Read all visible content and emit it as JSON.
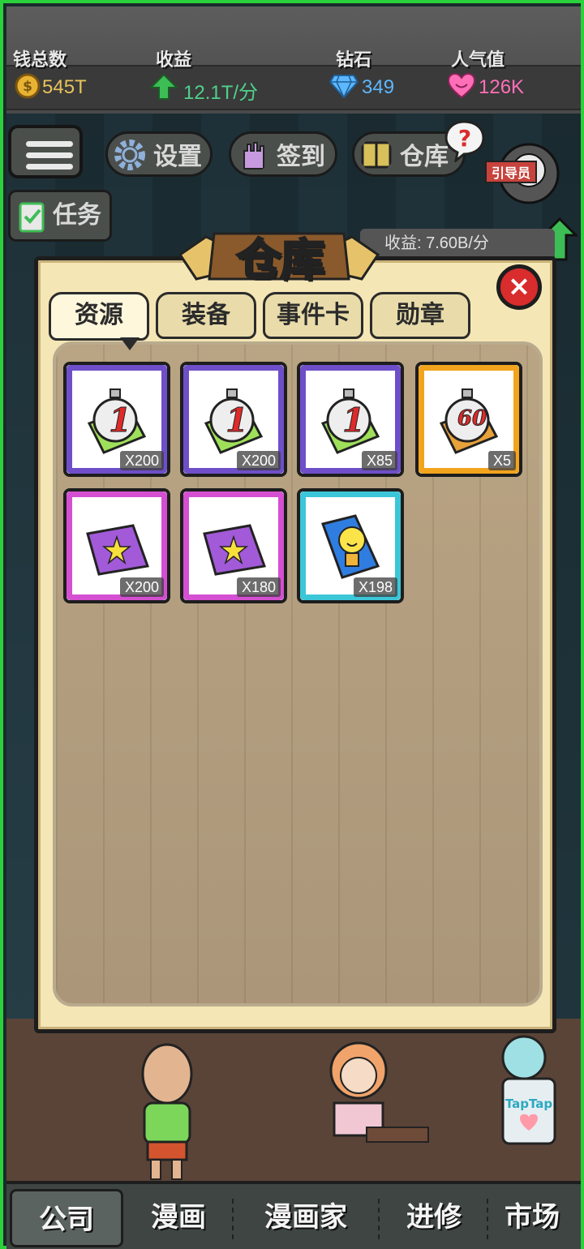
{
  "status": {
    "money": {
      "label": "钱总数",
      "value": "545T",
      "color": "#e8c25a"
    },
    "income": {
      "label": "收益",
      "value": "12.1T/分",
      "color": "#4fd18a"
    },
    "diamond": {
      "label": "钻石",
      "value": "349",
      "color": "#5db7ff"
    },
    "popularity": {
      "label": "人气值",
      "value": "126K",
      "color": "#ff6fb8"
    }
  },
  "game_menu": {
    "settings": "设置",
    "checkin": "签到",
    "warehouse": "仓库",
    "task": "任务",
    "guide": "引导员",
    "income_rate": "收益: 7.60B/分"
  },
  "modal": {
    "title": "仓库",
    "close": "×",
    "tabs": [
      {
        "label": "资源",
        "active": true
      },
      {
        "label": "装备",
        "active": false
      },
      {
        "label": "事件卡",
        "active": false
      },
      {
        "label": "勋章",
        "active": false
      }
    ],
    "items": [
      {
        "icon": "stopwatch-1-icon",
        "number": "1",
        "qty": "X200",
        "frame": "#6e4fc9"
      },
      {
        "icon": "stopwatch-1-icon",
        "number": "1",
        "qty": "X200",
        "frame": "#6e4fc9"
      },
      {
        "icon": "stopwatch-1-icon",
        "number": "1",
        "qty": "X85",
        "frame": "#6e4fc9"
      },
      {
        "icon": "stopwatch-60-icon",
        "number": "60",
        "qty": "X5",
        "frame": "#f2a41d"
      },
      {
        "icon": "star-flag-icon",
        "qty": "X200",
        "frame": "#d44fd1"
      },
      {
        "icon": "star-flag-icon",
        "qty": "X180",
        "frame": "#d44fd1"
      },
      {
        "icon": "lightbulb-card-icon",
        "qty": "X198",
        "frame": "#3cc6d8"
      }
    ]
  },
  "bottom_nav": [
    {
      "label": "公司",
      "active": true
    },
    {
      "label": "漫画",
      "active": false
    },
    {
      "label": "漫画家",
      "active": false
    },
    {
      "label": "进修",
      "active": false
    },
    {
      "label": "市场",
      "active": false
    }
  ]
}
